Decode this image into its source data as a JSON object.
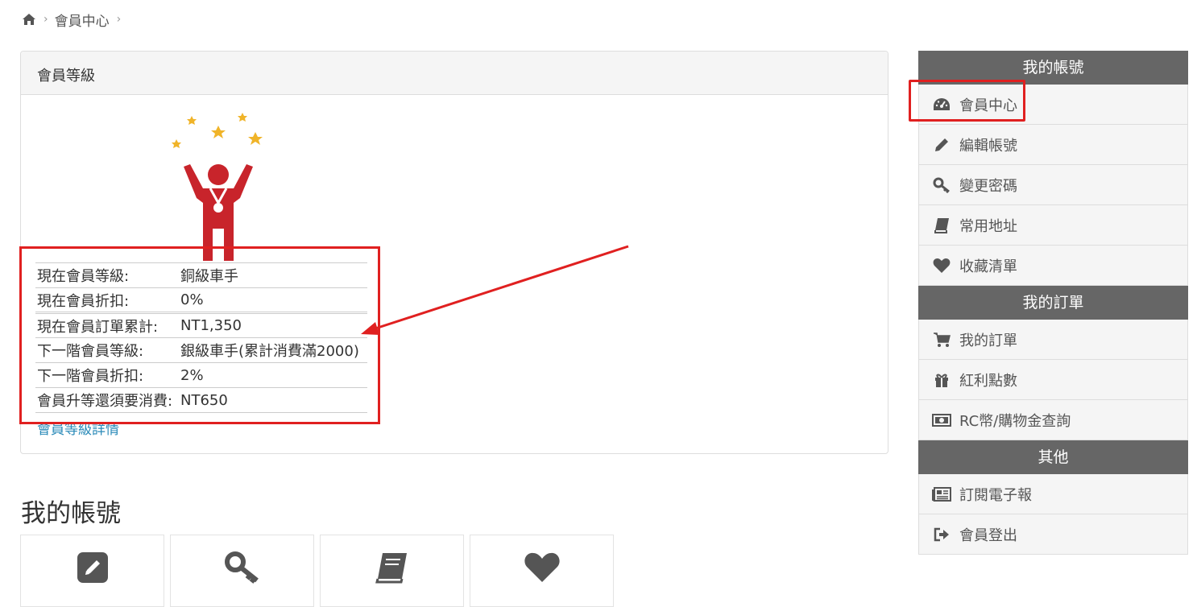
{
  "breadcrumb": {
    "home_icon": "home-icon",
    "current": "會員中心"
  },
  "panel": {
    "title": "會員等級"
  },
  "level_info": {
    "rows": [
      {
        "label": "現在會員等級:",
        "value": "銅級車手"
      },
      {
        "label": "現在會員折扣:",
        "value": "0%"
      },
      {
        "label": "現在會員訂單累計:",
        "value": "NT1,350"
      },
      {
        "label": "下一階會員等級:",
        "value": "銀級車手(累計消費滿2000)"
      },
      {
        "label": "下一階會員折扣:",
        "value": "2%"
      },
      {
        "label": "會員升等還須要消費:",
        "value": "NT650"
      }
    ],
    "detail_link": "會員等級詳情"
  },
  "account_section": {
    "title": "我的帳號"
  },
  "sidebar": {
    "groups": [
      {
        "title": "我的帳號",
        "items": [
          {
            "label": "會員中心",
            "icon": "dashboard-icon"
          },
          {
            "label": "編輯帳號",
            "icon": "pencil-icon"
          },
          {
            "label": "變更密碼",
            "icon": "key-icon"
          },
          {
            "label": "常用地址",
            "icon": "book-icon"
          },
          {
            "label": "收藏清單",
            "icon": "heart-icon"
          }
        ]
      },
      {
        "title": "我的訂單",
        "items": [
          {
            "label": "我的訂單",
            "icon": "cart-icon"
          },
          {
            "label": "紅利點數",
            "icon": "gift-icon"
          },
          {
            "label": "RC幣/購物金查詢",
            "icon": "money-icon"
          }
        ]
      },
      {
        "title": "其他",
        "items": [
          {
            "label": "訂閱電子報",
            "icon": "newspaper-icon"
          },
          {
            "label": "會員登出",
            "icon": "logout-icon"
          }
        ]
      }
    ]
  },
  "colors": {
    "annotation_red": "#e02020",
    "sidebar_header": "#666666",
    "link": "#2a8ab8",
    "figure_red": "#c8242b",
    "star": "#f0b429"
  }
}
